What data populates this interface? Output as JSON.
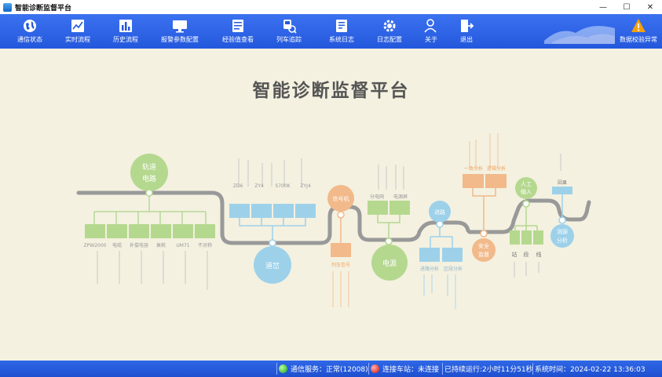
{
  "window": {
    "title": "智能诊断监督平台",
    "minimize": "—",
    "maximize": "☐",
    "close": "✕"
  },
  "toolbar": {
    "items": [
      {
        "label": "通信状态",
        "icon": "globe-icon"
      },
      {
        "label": "实时流程",
        "icon": "realtime-chart-icon"
      },
      {
        "label": "历史流程",
        "icon": "bar-chart-icon"
      },
      {
        "label": "报警参数配置",
        "icon": "monitor-icon"
      },
      {
        "label": "经验值查看",
        "icon": "document-icon"
      },
      {
        "label": "列车追踪",
        "icon": "train-search-icon"
      },
      {
        "label": "系统日志",
        "icon": "log-icon"
      },
      {
        "label": "日志配置",
        "icon": "gear-icon"
      },
      {
        "label": "关于",
        "icon": "users-icon"
      },
      {
        "label": "退出",
        "icon": "exit-icon"
      }
    ],
    "alert": {
      "label": "数据校验异常",
      "icon": "warning-icon",
      "color": "#f5a00a"
    }
  },
  "main": {
    "title": "智能诊断监督平台",
    "diagram": {
      "track_circuit": {
        "label1": "轨道",
        "label2": "电路",
        "devices": [
          "ZPW2000",
          "电缆",
          "补偿电容",
          "衰耗",
          "UM71",
          "不对称"
        ]
      },
      "switch": {
        "label": "道岔",
        "devices": [
          "ZD6",
          "ZY4",
          "S700K",
          "ZYJ4"
        ]
      },
      "signal": {
        "label": "信号机",
        "sub": "列车信号"
      },
      "power": {
        "label": "电源",
        "devices": [
          "分电网",
          "电源屏"
        ]
      },
      "route": {
        "label": "进路",
        "devices": [
          "进路分析",
          "区段分析"
        ]
      },
      "safety": {
        "label1": "安全",
        "label2": "监督",
        "devices": [
          "一致分析",
          "逻辑分析"
        ]
      },
      "manual": {
        "label1": "人工",
        "label2": "输入",
        "devices": [
          "站",
          "段",
          "线"
        ]
      },
      "factor": {
        "label1": "测源",
        "label2": "分析",
        "sub": "因果"
      }
    }
  },
  "status": {
    "comm_service": "通信服务：正常(12008)",
    "station_link": "连接车站：未连接",
    "runtime": "已持续运行:2小时11分51秒",
    "system_time": "系统时间：2024-02-22 13:36:03",
    "ok_color": "#19a21b",
    "error_color": "#d8120b"
  }
}
